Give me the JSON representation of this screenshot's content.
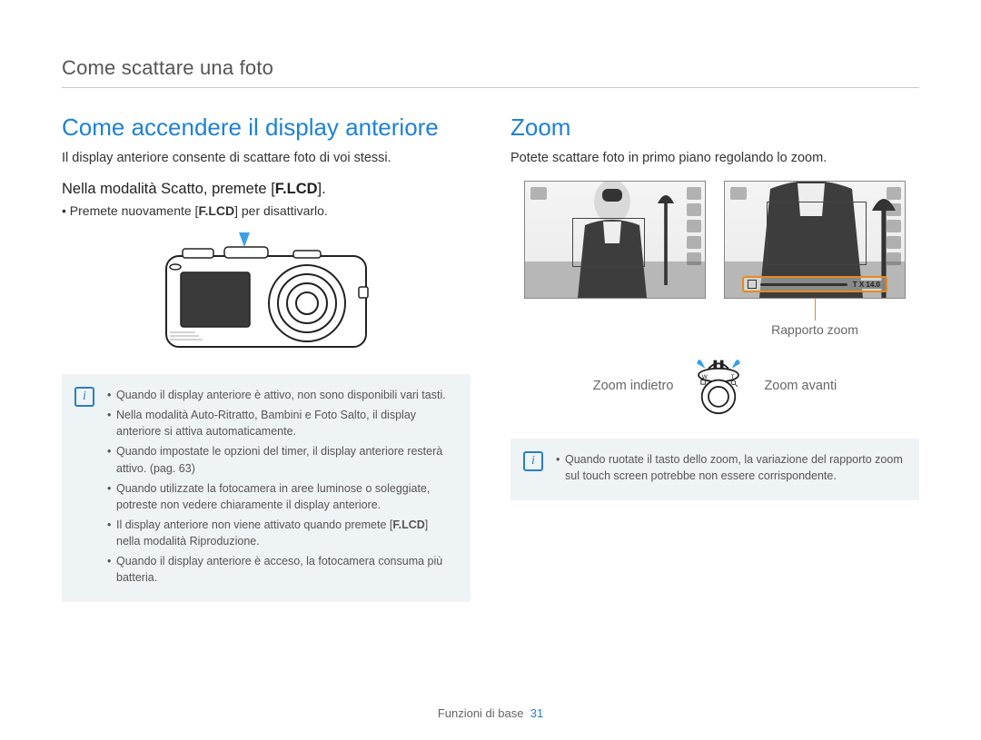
{
  "header": {
    "breadcrumb": "Come scattare una foto"
  },
  "left": {
    "title": "Come accendere il display anteriore",
    "lead": "Il display anteriore consente di scattare foto di voi stessi.",
    "step": "Nella modalità Scatto, premete ",
    "step_button": "F.LCD",
    "step_suffix": ".",
    "bullet_prefix": "Premete nuovamente ",
    "bullet_button": "F.LCD",
    "bullet_suffix": " per disattivarlo.",
    "notes": [
      "Quando il display anteriore è attivo, non sono disponibili vari tasti.",
      "Nella modalità Auto-Ritratto, Bambini e Foto Salto, il display anteriore si attiva automaticamente.",
      "Quando impostate le opzioni del timer, il display anteriore resterà attivo. (pag. 63)",
      "Quando utilizzate la fotocamera in aree luminose o soleggiate, potreste non vedere chiaramente il display anteriore.",
      "Il display anteriore non viene attivato quando premete [F.LCD] nella modalità Riproduzione.",
      "Quando il display anteriore è acceso, la fotocamera consuma più batteria."
    ],
    "note_flcd_index": 4
  },
  "right": {
    "title": "Zoom",
    "lead": "Potete scattare foto in primo piano regolando lo zoom.",
    "zoom_ratio_label": "Rapporto zoom",
    "zoom_out_label": "Zoom indietro",
    "zoom_in_label": "Zoom avanti",
    "zoom_bar_text": "T X 14.0",
    "note": "Quando ruotate il tasto dello zoom, la variazione del rapporto zoom sul touch screen potrebbe non essere corrispondente."
  },
  "footer": {
    "section": "Funzioni di base",
    "page": "31"
  }
}
